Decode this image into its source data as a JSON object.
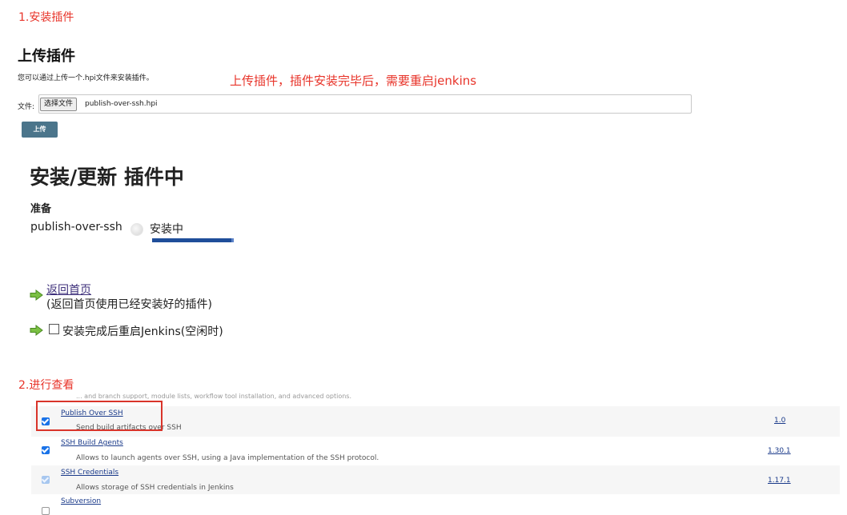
{
  "steps": {
    "step1": "1.安装插件",
    "step2": "2.进行查看"
  },
  "upload": {
    "title": "上传插件",
    "description": "您可以通过上传一个.hpi文件来安装插件。",
    "annotation": "上传插件，插件安装完毕后，需要重启jenkins",
    "file_label": "文件:",
    "choose_button": "选择文件",
    "file_name": "publish-over-ssh.hpi",
    "upload_button": "上传"
  },
  "install": {
    "title": "安装/更新 插件中",
    "prepare_label": "准备",
    "plugin_name": "publish-over-ssh",
    "status": "安装中",
    "progress": 1.0
  },
  "links": {
    "back_home": "返回首页",
    "back_home_desc": "(返回首页使用已经安装好的插件)",
    "restart_label": "安装完成后重启Jenkins(空闲时)",
    "restart_checked": false
  },
  "plugins": {
    "cut_text": "... and branch support, module lists, workflow tool installation, and advanced options.",
    "rows": [
      {
        "name": "Publish Over SSH",
        "description": "Send build artifacts over SSH",
        "version": "1.0",
        "state": "checked"
      },
      {
        "name": "SSH Build Agents",
        "description": "Allows to launch agents over SSH, using a Java implementation of the SSH protocol.",
        "version": "1.30.1",
        "state": "checked"
      },
      {
        "name": "SSH Credentials",
        "description": "Allows storage of SSH credentials in Jenkins",
        "version": "1.17.1",
        "state": "disabled"
      },
      {
        "name": "Subversion",
        "description": "",
        "version": "",
        "state": "partial"
      }
    ]
  },
  "colors": {
    "annotation_red": "#e8342a",
    "upload_button": "#4b758b",
    "progress_bar": "#1f4e9a",
    "link": "#1a3a8a"
  }
}
